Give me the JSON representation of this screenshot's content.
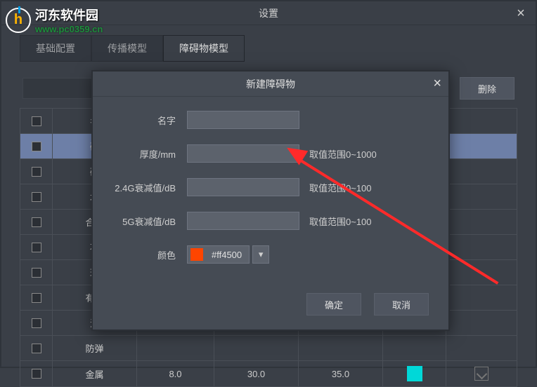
{
  "watermark": {
    "cn": "河东软件园",
    "url": "www.pc0359.cn"
  },
  "outer": {
    "title": "设置",
    "tabs": [
      "基础配置",
      "传播模型",
      "障碍物模型"
    ],
    "active_tab_index": 2,
    "delete_btn": "删除",
    "headers": {
      "name": "名",
      "thickness": "",
      "a24": "",
      "a5": "",
      "color": "",
      "action": ""
    },
    "rows_left": [
      "砖",
      "木",
      "合成",
      "石",
      "玻",
      "有色",
      "混",
      "防弹"
    ],
    "last_row": {
      "name": "金属",
      "t": "8.0",
      "a24": "30.0",
      "a5": "35.0",
      "swatch": "#00d8d8"
    }
  },
  "modal": {
    "title": "新建障碍物",
    "labels": {
      "name": "名字",
      "thickness": "厚度/mm",
      "att24": "2.4G衰减值/dB",
      "att5": "5G衰减值/dB",
      "color": "颜色"
    },
    "hints": {
      "thickness": "取值范围0~1000",
      "att24": "取值范围0~100",
      "att5": "取值范围0~100"
    },
    "color_value": "#ff4500",
    "ok": "确定",
    "cancel": "取消"
  }
}
